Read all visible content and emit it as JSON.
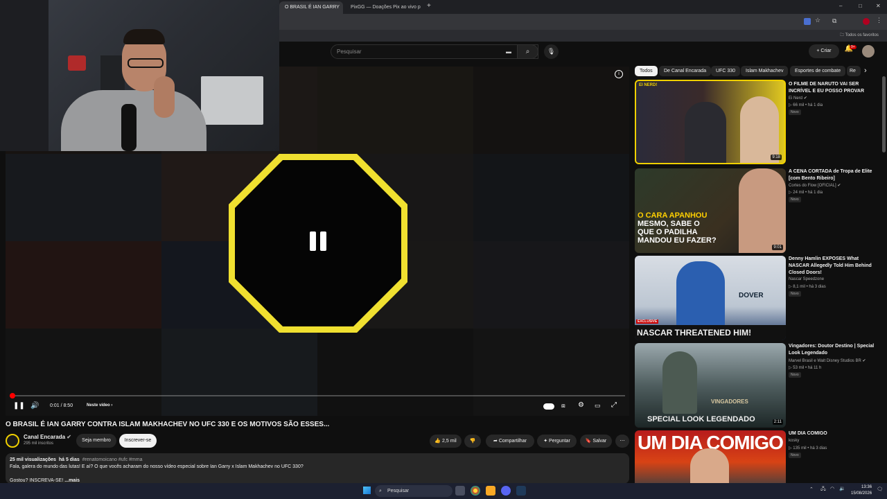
{
  "browser": {
    "tabs": [
      {
        "label": "O BRASIL É IAN GARRY",
        "active": true
      },
      {
        "label": "PixGG — Doações Pix ao vivo p",
        "active": false
      }
    ],
    "bookmarks_label": "Todos os favoritos"
  },
  "header": {
    "search_placeholder": "Pesquisar",
    "create_label": "+ Criar",
    "notifications_count": "9+"
  },
  "player": {
    "time": "0:01 / 8:50",
    "next_label": "Neste vídeo",
    "progress": 0.004
  },
  "video": {
    "title": "O BRASIL É IAN GARRY CONTRA ISLAM MAKHACHEV NO UFC 330 E OS MOTIVOS SÃO ESSES...",
    "channel": "Canal Encarada",
    "subscribers": "295 mil inscritos",
    "join_label": "Seja membro",
    "subscribe_label": "Inscrever-se",
    "likes": "2,5 mil",
    "share_label": "Compartilhar",
    "ask_label": "Perguntar",
    "save_label": "Salvar",
    "views": "25 mil visualizações",
    "age": "há 5 dias",
    "tags": "#renatomoicano #ufc #mma",
    "description_line1": "Fala, galera do mundo das lutas! E aí? O que vocês acharam do nosso vídeo especial sobre Ian Garry x Islam Makhachev no UFC 330?",
    "description_line2": "Gostou? INSCREVA-SE!",
    "more_label": "...mais"
  },
  "chips": [
    "Todos",
    "De Canal Encarada",
    "UFC 330",
    "Islam Makhachev",
    "Esportes de combate",
    "Re"
  ],
  "sidebar": [
    {
      "title": "O FILME DE NARUTO VAI SER INCRÍVEL E EU POSSO PROVAR",
      "channel": "Ei Nerd",
      "views": "66 mil",
      "age": "há 1 dia",
      "badge": "Novo",
      "duration": "9:18",
      "thumb_text": "EI NERD!"
    },
    {
      "title": "A CENA CORTADA de Tropa de Elite [com Bento Ribeiro]",
      "channel": "Cortes do Flow [OFICIAL]",
      "views": "24 mil",
      "age": "há 1 dia",
      "badge": "Novo",
      "duration": "9:01",
      "thumb_text_line1": "O CARA APANHOU",
      "thumb_text_line2": "MESMO, SABE O",
      "thumb_text_line3": "QUE O PADILHA",
      "thumb_text_line4": "MANDOU EU FAZER?"
    },
    {
      "title": "Denny Hamlin EXPOSES What NASCAR Allegedly Told Him Behind Closed Doors!",
      "channel": "Nascar Speedzone",
      "views": "8,1 mil",
      "age": "há 3 dias",
      "badge": "Novo",
      "duration": "13:04",
      "thumb_text": "NASCAR THREATENED HIM!",
      "thumb_label": "EXCLUSIVE",
      "thumb_sign": "DOVER"
    },
    {
      "title": "Vingadores: Doutor Destino | Special Look Legendado",
      "channel": "Marvel Brasil e Walt Disney Studios BR",
      "views": "53 mil",
      "age": "há 11 h",
      "badge": "Novo",
      "duration": "2:11",
      "thumb_text": "SPECIAL LOOK LEGENDADO",
      "thumb_logo": "VINGADORES"
    },
    {
      "title": "UM DIA COMIGO",
      "channel": "kosky",
      "views": "135 mil",
      "age": "há 3 dias",
      "badge": "Novo",
      "thumb_text": "UM DIA COMIGO"
    }
  ],
  "taskbar": {
    "search_label": "Pesquisar",
    "time": "13:36",
    "date": "15/08/2026"
  }
}
